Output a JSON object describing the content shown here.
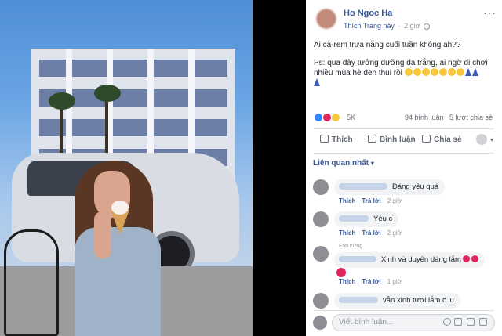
{
  "post": {
    "author": "Ho Ngoc Ha",
    "like_page": "Thích Trang này",
    "separator": "·",
    "time": "2 giờ",
    "text_line1": "Ai cà-rem trưa nắng cuối tuần không ah??",
    "text_line2": "Ps: qua đây tưởng dưỡng da trắng, ai ngờ đi chơi nhiều mùa hè đen thui rồi",
    "more": "···"
  },
  "reactions": {
    "count": "5K",
    "comments": "94 bình luận",
    "shares": "5 lượt chia sẻ",
    "colors": {
      "like": "#2d88ff",
      "love": "#e0245e",
      "haha": "#f7c63d"
    }
  },
  "actions": {
    "like": "Thích",
    "comment": "Bình luận",
    "share": "Chia sẻ"
  },
  "filter": "Liên quan nhất",
  "filter_caret": "▾",
  "comments": [
    {
      "text": "Đáng yêu quá",
      "reply": "Trả lời",
      "time": "2 giờ",
      "like": "Thích",
      "sep": "·"
    },
    {
      "text": "Yêu c",
      "reply": "Trả lời",
      "time": "2 giờ",
      "like": "Thích",
      "sep": "·"
    },
    {
      "badge": "Fan cứng",
      "text": "Xinh và duyên dáng lắm",
      "reply": "Trả lời",
      "time": "1 giờ",
      "like": "Thích",
      "sep": "·"
    },
    {
      "text": "vẫn xinh tươi lắm c iu"
    }
  ],
  "composer": {
    "placeholder": "Viết bình luận..."
  },
  "icons": [
    "globe-icon",
    "like-icon",
    "comment-icon",
    "share-icon",
    "emoji-icon",
    "gif-icon",
    "sticker-icon",
    "camera-icon",
    "heart-icon",
    "dress-icon"
  ]
}
